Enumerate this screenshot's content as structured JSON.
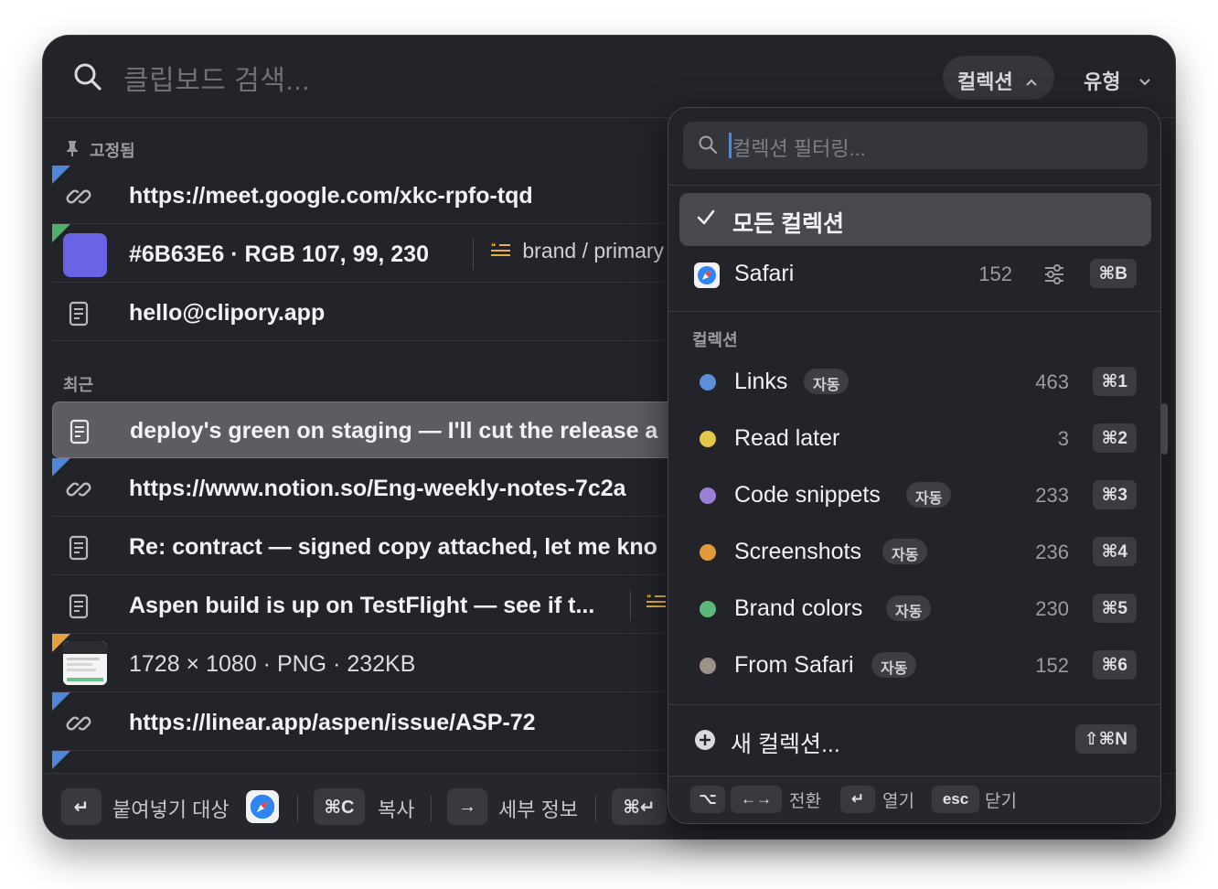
{
  "search": {
    "placeholder": "클립보드 검색..."
  },
  "header": {
    "collection_label": "컬렉션",
    "type_label": "유형"
  },
  "pinned": {
    "title": "고정됨",
    "items": [
      {
        "text": "https://meet.google.com/xkc-rpfo-tqd",
        "icon": "link-icon"
      },
      {
        "text": "#6B63E6 · RGB 107, 99, 230",
        "tag": "brand / primary",
        "swatch": "#6B63E6"
      },
      {
        "text": "hello@clipory.app",
        "icon": "document-icon"
      }
    ]
  },
  "recent": {
    "title": "최근",
    "items": [
      {
        "text": "deploy's green on staging — I'll cut the release a",
        "icon": "document-icon",
        "selected": true
      },
      {
        "text": "https://www.notion.so/Eng-weekly-notes-7c2a",
        "icon": "link-icon"
      },
      {
        "text": "Re: contract — signed copy attached, let me kno",
        "icon": "document-icon"
      },
      {
        "text": "Aspen build is up on TestFlight — see if t...",
        "icon": "document-icon"
      },
      {
        "text": "1728 × 1080 · PNG · 232KB",
        "icon": "image-thumbnail"
      },
      {
        "text": "https://linear.app/aspen/issue/ASP-72",
        "icon": "link-icon"
      }
    ]
  },
  "footer": {
    "enter_key": "↵",
    "paste_label": "붙여넣기 대상",
    "copy_key": "⌘C",
    "copy_label": "복사",
    "arrow_key": "→",
    "detail_label": "세부 정보",
    "cmd_enter_key": "⌘↵"
  },
  "popover": {
    "filter_placeholder": "컬렉션 필터링...",
    "all_collections": "모든 컬렉션",
    "source": {
      "name": "Safari",
      "count": "152",
      "shortcut": "⌘B"
    },
    "section_title": "컬렉션",
    "auto_label": "자동",
    "collections": [
      {
        "name": "Links",
        "auto": true,
        "count": "463",
        "shortcut": "⌘1",
        "color": "#5b8fd9"
      },
      {
        "name": "Read later",
        "auto": false,
        "count": "3",
        "shortcut": "⌘2",
        "color": "#e3c84a"
      },
      {
        "name": "Code snippets",
        "auto": true,
        "count": "233",
        "shortcut": "⌘3",
        "color": "#9a7fd6"
      },
      {
        "name": "Screenshots",
        "auto": true,
        "count": "236",
        "shortcut": "⌘4",
        "color": "#e39a3c"
      },
      {
        "name": "Brand colors",
        "auto": true,
        "count": "230",
        "shortcut": "⌘5",
        "color": "#5bb87a"
      },
      {
        "name": "From Safari",
        "auto": true,
        "count": "152",
        "shortcut": "⌘6",
        "color": "#9a9287"
      }
    ],
    "new_collection": {
      "label": "새 컬렉션...",
      "shortcut": "⇧⌘N"
    },
    "footer": {
      "opt_key": "⌥",
      "switch_key": "←→",
      "switch_label": "전환",
      "open_key": "↵",
      "open_label": "열기",
      "esc_key": "esc",
      "close_label": "닫기"
    }
  }
}
